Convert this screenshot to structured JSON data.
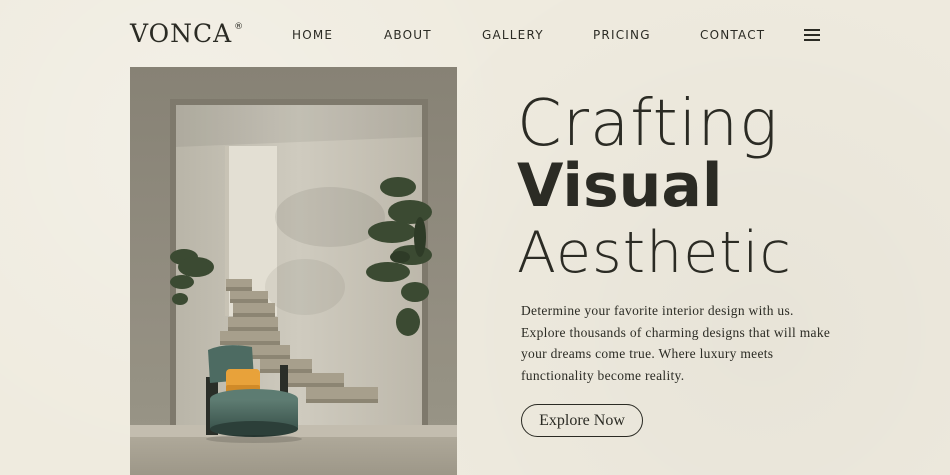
{
  "brand": {
    "name": "VONCA",
    "mark": "®"
  },
  "nav": {
    "home": "HOME",
    "about": "ABOUT",
    "gallery": "GALLERY",
    "pricing": "PRICING",
    "contact": "CONTACT",
    "menu_icon": "hamburger-menu-icon"
  },
  "hero": {
    "line1": "Crafting",
    "line2": "Visual",
    "line3": "Aesthetic",
    "desc_lines": [
      "Determine your favorite interior design with us.",
      "Explore thousands of charming designs that will make",
      "your dreams come true. Where luxury meets",
      "functionality become reality."
    ],
    "cta_label": "Explore Now"
  },
  "colors": {
    "background": "#efebdf",
    "text": "#2b2b24",
    "wall": "#a9a495",
    "chair": "#4d6b62",
    "cushion": "#e8a23a"
  }
}
